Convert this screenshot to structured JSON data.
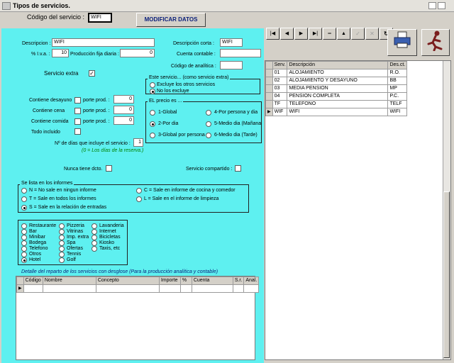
{
  "window": {
    "title": "Tipos de servicios."
  },
  "header": {
    "codigo_label": "Código del servicio :",
    "codigo_value": "WIFI",
    "modify_button": "MODIFICAR DATOS"
  },
  "form": {
    "descripcion_label": "Descripcion :",
    "descripcion_value": "WIFI",
    "desc_corta_label": "Descripción corta :",
    "desc_corta_value": "WIFI",
    "iva_label": "% I.v.a. :",
    "iva_value": "10",
    "prod_label": "Producción fija diaria :",
    "prod_value": "0",
    "cuenta_label": "Cuenta contable :",
    "cuenta_value": "",
    "analitica_label": "Código de analítica :",
    "analitica_value": "",
    "extra_label": "Servicio extra",
    "desayuno_label": "Contiene desayuno",
    "cena_label": "Contiene cena",
    "comida_label": "Contiene comida",
    "porte_label": "porte prod. :",
    "desayuno_value": "0",
    "cena_value": "0",
    "comida_value": "0",
    "todo_label": "Todo incluido",
    "dias_label": "Nº de días que incluye el servicio :",
    "dias_value": "1",
    "dias_hint": "(0 = Los días de la reserva.)",
    "nunca_label": "Nunca tiene dcto.",
    "compartido_label": "Servicio compartido :"
  },
  "este_servicio": {
    "title": "Este servicio... (como servicio extra)",
    "opt1": "Excluye los otros servicios",
    "opt2": "No los excluye"
  },
  "precio": {
    "title": "EL precio es ...",
    "opts": [
      "1-Global",
      "2-Por dia",
      "3-Global por persona",
      "4-Por persona y dia",
      "5-Medio dia (Mañana",
      "6-Medio dia (Tarde)"
    ]
  },
  "informes": {
    "title": "Se lista en los informes",
    "n": "N = No sale en ningun informe",
    "t": "T = Sale en todos los informes",
    "s": "S = Sale en la relación de entradas",
    "c": "C = Sale en informe de cocina y comedor",
    "l": "L = Sale en el informe de limpieza"
  },
  "categorias": {
    "col1": [
      "Restaurante",
      "Bar",
      "Minibar",
      "Bodega",
      "Telefono",
      "Otros",
      "Hotel"
    ],
    "col2": [
      "Pizzeria",
      "Vitrinas",
      "Imp. extra",
      "Spa",
      "Ofertas",
      "Tennis",
      "Golf"
    ],
    "col3": [
      "Lavanderia",
      "Internet",
      "Bicicletas",
      "Kiosko",
      "Taxis, etc"
    ]
  },
  "desglose": {
    "title": "Detalle del reparto de los servicios con desglose (Para la producción analítica y contable)",
    "headers": [
      "Código",
      "Nombre",
      "Concepto",
      "Importe",
      "%",
      "Cuenta",
      "S.r.",
      "Anal."
    ]
  },
  "services_table": {
    "headers": [
      "Serv.",
      "Descripción",
      "Des.ct."
    ],
    "rows": [
      [
        "01",
        "ALOJAMIENTO",
        "R.O."
      ],
      [
        "02",
        "ALOJAMIENTO Y DESAYUNO",
        "BB"
      ],
      [
        "03",
        "MEDIA PENSION",
        "MP"
      ],
      [
        "04",
        "PENSION COMPLETA",
        "P.C."
      ],
      [
        "TF",
        "TELEFONO",
        "TELF"
      ],
      [
        "WIF",
        "WIFI",
        "WIFI"
      ]
    ]
  },
  "colors": {
    "panel": "#5ef0f0",
    "window_bg": "#d4d0c8",
    "hint": "#008000"
  }
}
